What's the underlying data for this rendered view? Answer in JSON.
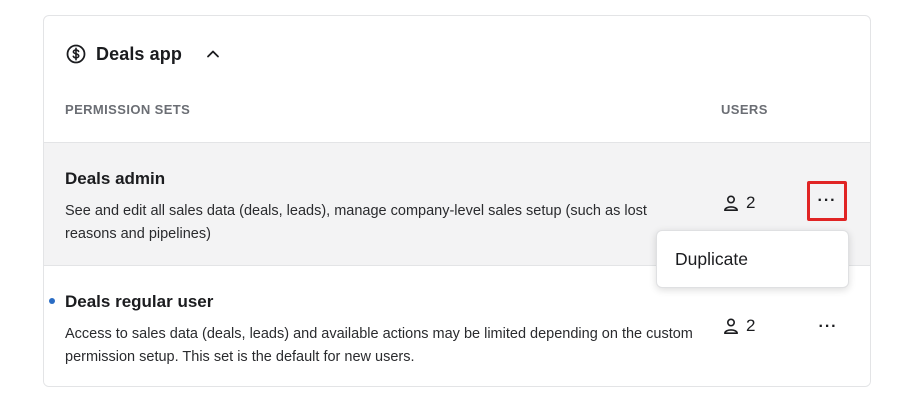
{
  "app": {
    "title": "Deals app",
    "icon": "dollar-circle-icon",
    "collapse_icon": "chevron-up-icon"
  },
  "columns": {
    "permission_sets": "PERMISSION SETS",
    "users": "USERS"
  },
  "rows": [
    {
      "title": "Deals admin",
      "description": "See and edit all sales data (deals, leads), manage company-level sales setup (such as lost reasons and pipelines)",
      "users_count": "2",
      "users_icon": "user-icon",
      "more_icon": "more-horizontal-icon",
      "more_label": "···",
      "highlighted": true
    },
    {
      "title": "Deals regular user",
      "description": "Access to sales data (deals, leads) and available actions may be limited depending on the custom permission setup. This set is the default for new users.",
      "users_count": "2",
      "users_icon": "user-icon",
      "more_icon": "more-horizontal-icon",
      "more_label": "···",
      "default_indicator_color": "#2a6cc4"
    }
  ],
  "dropdown": {
    "items": [
      "Duplicate"
    ]
  },
  "colors": {
    "highlight_border": "#e02424",
    "selected_row_bg": "#f3f3f4"
  }
}
